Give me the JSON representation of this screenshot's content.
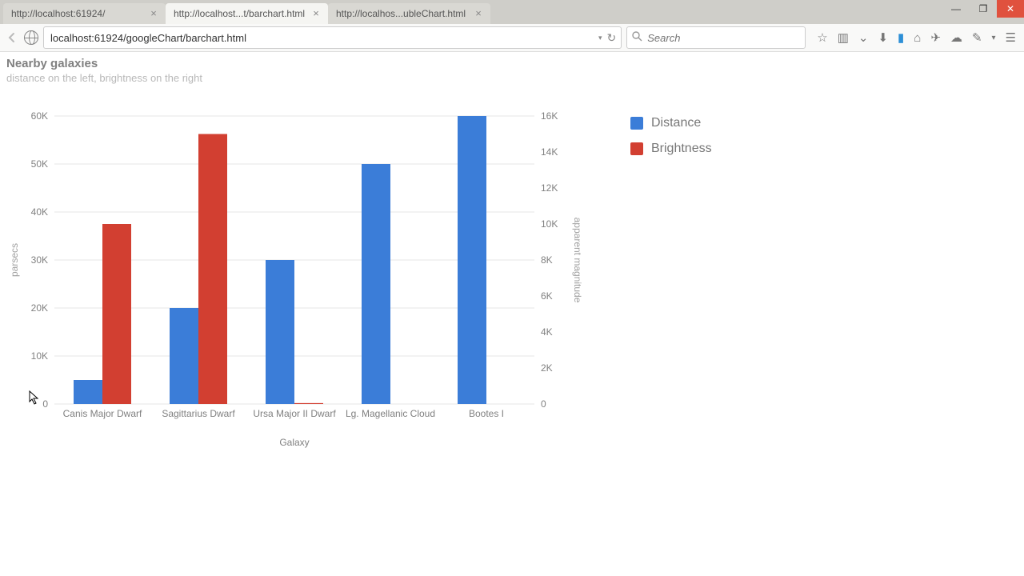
{
  "browser": {
    "tabs": [
      {
        "title": "http://localhost:61924/",
        "active": false
      },
      {
        "title": "http://localhost...t/barchart.html",
        "active": true
      },
      {
        "title": "http://localhos...ubleChart.html",
        "active": false
      }
    ],
    "url": "localhost:61924/googleChart/barchart.html",
    "search_placeholder": "Search"
  },
  "chart_data": {
    "type": "bar",
    "title": "Nearby galaxies",
    "subtitle": "distance on the left, brightness on the right",
    "xlabel": "Galaxy",
    "y_left": {
      "label": "parsecs",
      "min": 0,
      "max": 60000,
      "ticks": [
        0,
        10000,
        20000,
        30000,
        40000,
        50000,
        60000
      ],
      "tick_labels": [
        "0",
        "10K",
        "20K",
        "30K",
        "40K",
        "50K",
        "60K"
      ]
    },
    "y_right": {
      "label": "apparent magnitude",
      "min": 0,
      "max": 16000,
      "ticks": [
        0,
        2000,
        4000,
        6000,
        8000,
        10000,
        12000,
        14000,
        16000
      ],
      "tick_labels": [
        "0",
        "2K",
        "4K",
        "6K",
        "8K",
        "10K",
        "12K",
        "14K",
        "16K"
      ]
    },
    "categories": [
      "Canis Major Dwarf",
      "Sagittarius Dwarf",
      "Ursa Major II Dwarf",
      "Lg. Magellanic Cloud",
      "Bootes I"
    ],
    "series": [
      {
        "name": "Distance",
        "axis": "left",
        "color": "#3b7dd8",
        "values": [
          5000,
          20000,
          30000,
          50000,
          60000
        ]
      },
      {
        "name": "Brightness",
        "axis": "right",
        "color": "#d23f31",
        "values": [
          10000,
          15000,
          50,
          0,
          0
        ]
      }
    ],
    "grid": true
  }
}
